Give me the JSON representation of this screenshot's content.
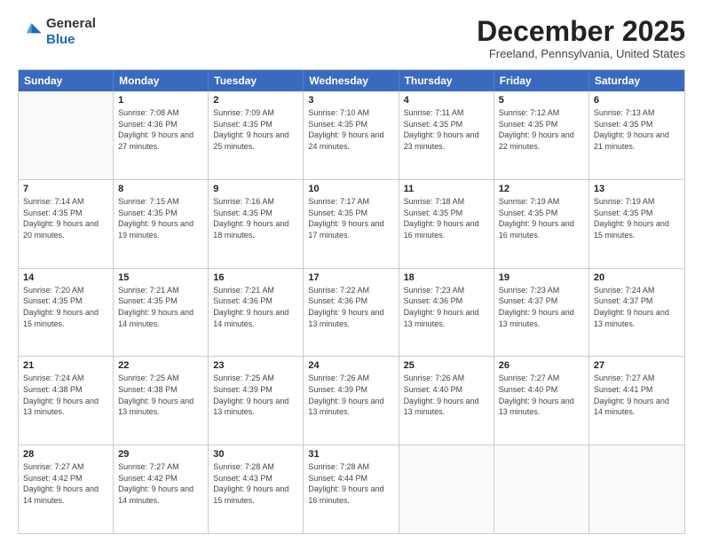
{
  "logo": {
    "general": "General",
    "blue": "Blue"
  },
  "title": "December 2025",
  "location": "Freeland, Pennsylvania, United States",
  "days_of_week": [
    "Sunday",
    "Monday",
    "Tuesday",
    "Wednesday",
    "Thursday",
    "Friday",
    "Saturday"
  ],
  "weeks": [
    [
      {
        "day": "",
        "empty": true
      },
      {
        "day": "1",
        "sunrise": "7:08 AM",
        "sunset": "4:36 PM",
        "daylight": "9 hours and 27 minutes."
      },
      {
        "day": "2",
        "sunrise": "7:09 AM",
        "sunset": "4:35 PM",
        "daylight": "9 hours and 25 minutes."
      },
      {
        "day": "3",
        "sunrise": "7:10 AM",
        "sunset": "4:35 PM",
        "daylight": "9 hours and 24 minutes."
      },
      {
        "day": "4",
        "sunrise": "7:11 AM",
        "sunset": "4:35 PM",
        "daylight": "9 hours and 23 minutes."
      },
      {
        "day": "5",
        "sunrise": "7:12 AM",
        "sunset": "4:35 PM",
        "daylight": "9 hours and 22 minutes."
      },
      {
        "day": "6",
        "sunrise": "7:13 AM",
        "sunset": "4:35 PM",
        "daylight": "9 hours and 21 minutes."
      }
    ],
    [
      {
        "day": "7",
        "sunrise": "7:14 AM",
        "sunset": "4:35 PM",
        "daylight": "9 hours and 20 minutes."
      },
      {
        "day": "8",
        "sunrise": "7:15 AM",
        "sunset": "4:35 PM",
        "daylight": "9 hours and 19 minutes."
      },
      {
        "day": "9",
        "sunrise": "7:16 AM",
        "sunset": "4:35 PM",
        "daylight": "9 hours and 18 minutes."
      },
      {
        "day": "10",
        "sunrise": "7:17 AM",
        "sunset": "4:35 PM",
        "daylight": "9 hours and 17 minutes."
      },
      {
        "day": "11",
        "sunrise": "7:18 AM",
        "sunset": "4:35 PM",
        "daylight": "9 hours and 16 minutes."
      },
      {
        "day": "12",
        "sunrise": "7:19 AM",
        "sunset": "4:35 PM",
        "daylight": "9 hours and 16 minutes."
      },
      {
        "day": "13",
        "sunrise": "7:19 AM",
        "sunset": "4:35 PM",
        "daylight": "9 hours and 15 minutes."
      }
    ],
    [
      {
        "day": "14",
        "sunrise": "7:20 AM",
        "sunset": "4:35 PM",
        "daylight": "9 hours and 15 minutes."
      },
      {
        "day": "15",
        "sunrise": "7:21 AM",
        "sunset": "4:35 PM",
        "daylight": "9 hours and 14 minutes."
      },
      {
        "day": "16",
        "sunrise": "7:21 AM",
        "sunset": "4:36 PM",
        "daylight": "9 hours and 14 minutes."
      },
      {
        "day": "17",
        "sunrise": "7:22 AM",
        "sunset": "4:36 PM",
        "daylight": "9 hours and 13 minutes."
      },
      {
        "day": "18",
        "sunrise": "7:23 AM",
        "sunset": "4:36 PM",
        "daylight": "9 hours and 13 minutes."
      },
      {
        "day": "19",
        "sunrise": "7:23 AM",
        "sunset": "4:37 PM",
        "daylight": "9 hours and 13 minutes."
      },
      {
        "day": "20",
        "sunrise": "7:24 AM",
        "sunset": "4:37 PM",
        "daylight": "9 hours and 13 minutes."
      }
    ],
    [
      {
        "day": "21",
        "sunrise": "7:24 AM",
        "sunset": "4:38 PM",
        "daylight": "9 hours and 13 minutes."
      },
      {
        "day": "22",
        "sunrise": "7:25 AM",
        "sunset": "4:38 PM",
        "daylight": "9 hours and 13 minutes."
      },
      {
        "day": "23",
        "sunrise": "7:25 AM",
        "sunset": "4:39 PM",
        "daylight": "9 hours and 13 minutes."
      },
      {
        "day": "24",
        "sunrise": "7:26 AM",
        "sunset": "4:39 PM",
        "daylight": "9 hours and 13 minutes."
      },
      {
        "day": "25",
        "sunrise": "7:26 AM",
        "sunset": "4:40 PM",
        "daylight": "9 hours and 13 minutes."
      },
      {
        "day": "26",
        "sunrise": "7:27 AM",
        "sunset": "4:40 PM",
        "daylight": "9 hours and 13 minutes."
      },
      {
        "day": "27",
        "sunrise": "7:27 AM",
        "sunset": "4:41 PM",
        "daylight": "9 hours and 14 minutes."
      }
    ],
    [
      {
        "day": "28",
        "sunrise": "7:27 AM",
        "sunset": "4:42 PM",
        "daylight": "9 hours and 14 minutes."
      },
      {
        "day": "29",
        "sunrise": "7:27 AM",
        "sunset": "4:42 PM",
        "daylight": "9 hours and 14 minutes."
      },
      {
        "day": "30",
        "sunrise": "7:28 AM",
        "sunset": "4:43 PM",
        "daylight": "9 hours and 15 minutes."
      },
      {
        "day": "31",
        "sunrise": "7:28 AM",
        "sunset": "4:44 PM",
        "daylight": "9 hours and 16 minutes."
      },
      {
        "day": "",
        "empty": true
      },
      {
        "day": "",
        "empty": true
      },
      {
        "day": "",
        "empty": true
      }
    ]
  ]
}
